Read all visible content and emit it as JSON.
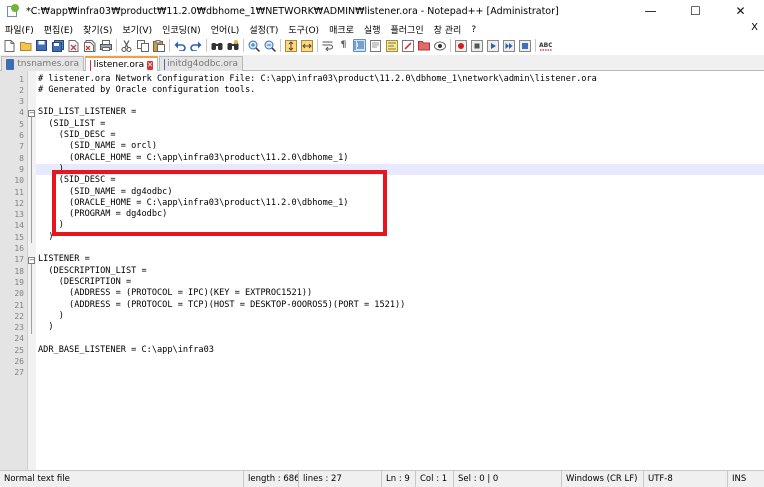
{
  "window": {
    "title": "*C:₩app₩infra03₩product₩11.2.0₩dbhome_1₩NETWORK₩ADMIN₩listener.ora - Notepad++ [Administrator]",
    "minimize": "—",
    "maximize": "☐",
    "close": "✕"
  },
  "menu": {
    "items": [
      "파일(F)",
      "편집(E)",
      "찾기(S)",
      "보기(V)",
      "인코딩(N)",
      "언어(L)",
      "설정(T)",
      "도구(O)",
      "매크로",
      "실행",
      "플러그인",
      "창 관리",
      "?"
    ],
    "close": "X"
  },
  "toolbar": {
    "icons": [
      "new-file-icon",
      "open-file-icon",
      "save-icon",
      "save-all-icon",
      "close-icon",
      "close-all-icon",
      "print-icon",
      "cut-icon",
      "copy-icon",
      "paste-icon",
      "undo-icon",
      "redo-icon",
      "find-icon",
      "replace-icon",
      "zoom-in-icon",
      "zoom-out-icon",
      "sync-vertical-icon",
      "sync-horizontal-icon",
      "word-wrap-icon",
      "show-all-chars-icon",
      "indent-guide-icon",
      "udl-icon",
      "doc-map-icon",
      "function-list-icon",
      "folder-workspace-icon",
      "monitoring-icon",
      "record-macro-icon",
      "stop-macro-icon",
      "play-macro-icon",
      "run-macro-multiple-icon",
      "save-macro-icon",
      "spell-check-icon"
    ]
  },
  "tabs": [
    {
      "label": "tnsnames.ora",
      "active": false,
      "modified": false
    },
    {
      "label": "listener.ora",
      "active": true,
      "modified": true
    },
    {
      "label": "initdg4odbc.ora",
      "active": false,
      "modified": false
    }
  ],
  "editor": {
    "current_line": 9,
    "lines": [
      "# listener.ora Network Configuration File: C:\\app\\infra03\\product\\11.2.0\\dbhome_1\\network\\admin\\listener.ora",
      "# Generated by Oracle configuration tools.",
      "",
      "SID_LIST_LISTENER =",
      "  (SID_LIST =",
      "    (SID_DESC =",
      "      (SID_NAME = orcl)",
      "      (ORACLE_HOME = C:\\app\\infra03\\product\\11.2.0\\dbhome_1)",
      "    )",
      "    (SID_DESC =",
      "      (SID_NAME = dg4odbc)",
      "      (ORACLE_HOME = C:\\app\\infra03\\product\\11.2.0\\dbhome_1)",
      "      (PROGRAM = dg4odbc)",
      "    )",
      "  )",
      "",
      "LISTENER =",
      "  (DESCRIPTION_LIST =",
      "    (DESCRIPTION =",
      "      (ADDRESS = (PROTOCOL = IPC)(KEY = EXTPROC1521))",
      "      (ADDRESS = (PROTOCOL = TCP)(HOST = DESKTOP-0OOROS5)(PORT = 1521))",
      "    )",
      "  )",
      "",
      "ADR_BASE_LISTENER = C:\\app\\infra03",
      "",
      ""
    ]
  },
  "status": {
    "file_type": "Normal text file",
    "length": "length : 686",
    "lines": "lines : 27",
    "ln": "Ln : 9",
    "col": "Col : 1",
    "sel": "Sel : 0 | 0",
    "eol": "Windows (CR LF)",
    "encoding": "UTF-8",
    "mode": "INS"
  },
  "colors": {
    "highlight_box": "#e5161e",
    "current_line": "#e8e8ff",
    "active_tab_accent": "#f0a040"
  }
}
